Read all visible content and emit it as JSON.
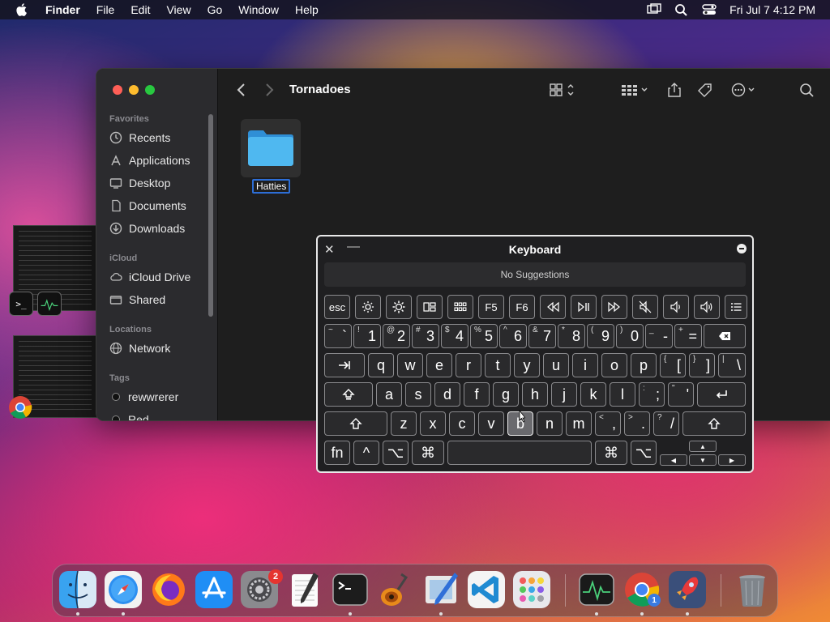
{
  "menubar": {
    "app": "Finder",
    "items": [
      "File",
      "Edit",
      "View",
      "Go",
      "Window",
      "Help"
    ],
    "clock": "Fri Jul 7  4:12 PM"
  },
  "finder": {
    "title": "Tornadoes",
    "sidebar": {
      "favorites_title": "Favorites",
      "favorites": [
        "Recents",
        "Applications",
        "Desktop",
        "Documents",
        "Downloads"
      ],
      "icloud_title": "iCloud",
      "icloud": [
        "iCloud Drive",
        "Shared"
      ],
      "locations_title": "Locations",
      "locations": [
        "Network"
      ],
      "tags_title": "Tags",
      "tags": [
        "rewwrerer",
        "Red"
      ]
    },
    "folder_name": "Hatties"
  },
  "keyboard": {
    "title": "Keyboard",
    "suggestions": "No Suggestions",
    "fn_row": [
      "esc",
      "",
      "",
      "",
      "",
      "F5",
      "F6",
      "",
      "",
      "",
      "",
      "",
      "",
      ""
    ],
    "number_row": [
      {
        "sub": "~",
        "main": "`"
      },
      {
        "sub": "!",
        "main": "1"
      },
      {
        "sub": "@",
        "main": "2"
      },
      {
        "sub": "#",
        "main": "3"
      },
      {
        "sub": "$",
        "main": "4"
      },
      {
        "sub": "%",
        "main": "5"
      },
      {
        "sub": "^",
        "main": "6"
      },
      {
        "sub": "&",
        "main": "7"
      },
      {
        "sub": "*",
        "main": "8"
      },
      {
        "sub": "(",
        "main": "9"
      },
      {
        "sub": ")",
        "main": "0"
      },
      {
        "sub": "_",
        "main": "-"
      },
      {
        "sub": "+",
        "main": "="
      }
    ],
    "row_q": [
      "q",
      "w",
      "e",
      "r",
      "t",
      "y",
      "u",
      "i",
      "o",
      "p"
    ],
    "row_q_extra": [
      {
        "sub": "{",
        "main": "["
      },
      {
        "sub": "}",
        "main": "]"
      },
      {
        "sub": "|",
        "main": "\\"
      }
    ],
    "row_a": [
      "a",
      "s",
      "d",
      "f",
      "g",
      "h",
      "j",
      "k",
      "l"
    ],
    "row_a_extra": [
      {
        "sub": ":",
        "main": ";"
      },
      {
        "sub": "\"",
        "main": "'"
      }
    ],
    "row_z": [
      "z",
      "x",
      "c",
      "v",
      "b",
      "n",
      "m"
    ],
    "row_z_extra": [
      {
        "sub": "<",
        "main": ","
      },
      {
        "sub": ">",
        "main": "."
      },
      {
        "sub": "?",
        "main": "/"
      }
    ],
    "bottom": {
      "fn": "fn",
      "ctrl": "^",
      "opt": "⌥",
      "cmd": "⌘"
    },
    "pressed_key": "b"
  },
  "dock": {
    "settings_badge": "2",
    "chrome_badge": "1"
  },
  "colors": {
    "folder_blue": "#3aa7e8",
    "selection_blue": "#2d6ed6",
    "badge_red": "#e5342f"
  }
}
